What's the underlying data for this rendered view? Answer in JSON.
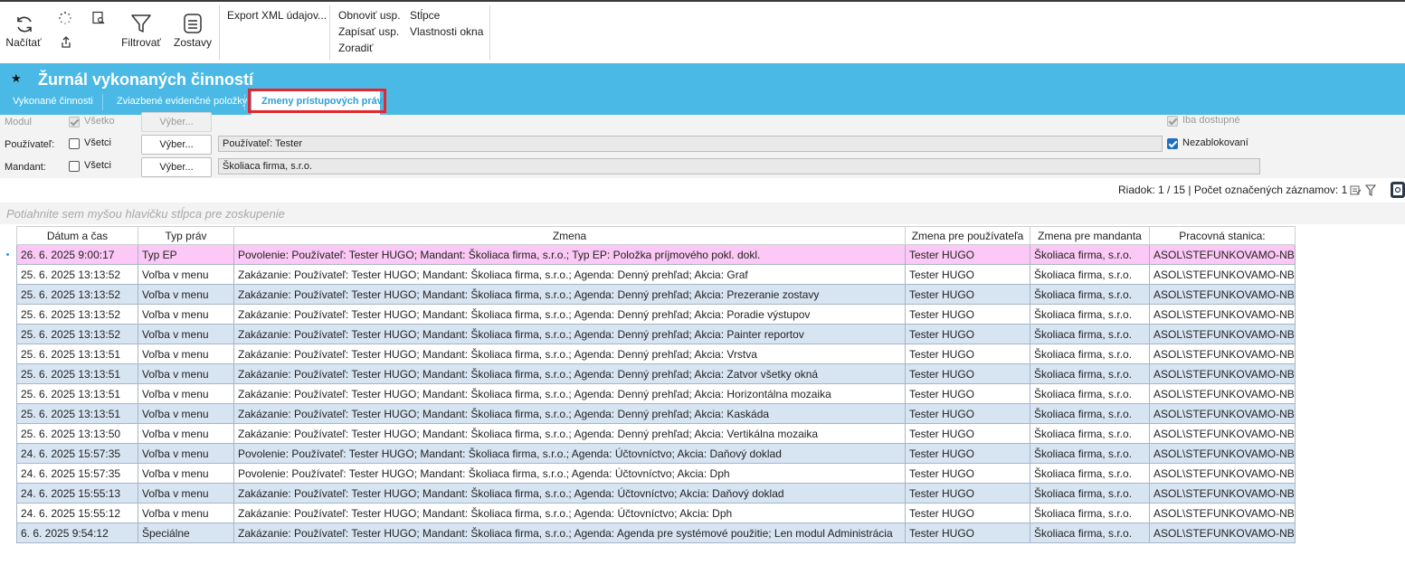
{
  "toolbar": {
    "load_label": "Načítať",
    "filter_label": "Filtrovať",
    "reports_label": "Zostavy",
    "export_xml_label": "Export XML údajov...",
    "refresh_settings_label": "Obnoviť usp.",
    "save_settings_label": "Zapísať usp.",
    "sort_label": "Zoradiť",
    "columns_label": "Stĺpce",
    "window_properties_label": "Vlastnosti okna"
  },
  "window": {
    "title": "Žurnál vykonaných činností",
    "tabs": [
      "Vykonané činnosti",
      "Zviazbené evidenčné položky",
      "Zmeny prístupových práv"
    ],
    "active_tab": "Zmeny prístupových práv"
  },
  "filters": {
    "module_label": "Modul",
    "module_all_label": "Všetko",
    "user_label": "Používateľ:",
    "user_all_label": "Všetci",
    "mandant_label": "Mandant:",
    "mandant_all_label": "Všetci",
    "select_button": "Výber...",
    "user_value": "Používateľ: Tester",
    "mandant_value": "Školiaca firma, s.r.o.",
    "only_available_label": "Iba dostupné",
    "unblocked_label": "Nezablokovaní"
  },
  "status": {
    "text": "Riadok: 1 / 15 | Počet označených záznamov: 1"
  },
  "group_hint": "Potiahnite sem myšou hlavičku stĺpca pre zoskupenie",
  "grid": {
    "columns": [
      "Dátum a čas",
      "Typ práv",
      "Zmena",
      "Zmena pre používateľa",
      "Zmena pre mandanta",
      "Pracovná stanica:"
    ],
    "rows": [
      [
        "26. 6. 2025 9:00:17",
        "Typ EP",
        "Povolenie: Používateľ: Tester HUGO; Mandant: Školiaca firma, s.r.o.; Typ EP: Položka príjmového pokl. dokl.",
        "Tester HUGO",
        "Školiaca firma, s.r.o.",
        "ASOL\\STEFUNKOVAMO-NB"
      ],
      [
        "25. 6. 2025 13:13:52",
        "Voľba v menu",
        "Zakázanie: Používateľ: Tester HUGO; Mandant: Školiaca firma, s.r.o.; Agenda: Denný prehľad; Akcia: Graf",
        "Tester HUGO",
        "Školiaca firma, s.r.o.",
        "ASOL\\STEFUNKOVAMO-NB"
      ],
      [
        "25. 6. 2025 13:13:52",
        "Voľba v menu",
        "Zakázanie: Používateľ: Tester HUGO; Mandant: Školiaca firma, s.r.o.; Agenda: Denný prehľad; Akcia: Prezeranie zostavy",
        "Tester HUGO",
        "Školiaca firma, s.r.o.",
        "ASOL\\STEFUNKOVAMO-NB"
      ],
      [
        "25. 6. 2025 13:13:52",
        "Voľba v menu",
        "Zakázanie: Používateľ: Tester HUGO; Mandant: Školiaca firma, s.r.o.; Agenda: Denný prehľad; Akcia: Poradie výstupov",
        "Tester HUGO",
        "Školiaca firma, s.r.o.",
        "ASOL\\STEFUNKOVAMO-NB"
      ],
      [
        "25. 6. 2025 13:13:52",
        "Voľba v menu",
        "Zakázanie: Používateľ: Tester HUGO; Mandant: Školiaca firma, s.r.o.; Agenda: Denný prehľad; Akcia: Painter reportov",
        "Tester HUGO",
        "Školiaca firma, s.r.o.",
        "ASOL\\STEFUNKOVAMO-NB"
      ],
      [
        "25. 6. 2025 13:13:51",
        "Voľba v menu",
        "Zakázanie: Používateľ: Tester HUGO; Mandant: Školiaca firma, s.r.o.; Agenda: Denný prehľad; Akcia: Vrstva",
        "Tester HUGO",
        "Školiaca firma, s.r.o.",
        "ASOL\\STEFUNKOVAMO-NB"
      ],
      [
        "25. 6. 2025 13:13:51",
        "Voľba v menu",
        "Zakázanie: Používateľ: Tester HUGO; Mandant: Školiaca firma, s.r.o.; Agenda: Denný prehľad; Akcia: Zatvor všetky okná",
        "Tester HUGO",
        "Školiaca firma, s.r.o.",
        "ASOL\\STEFUNKOVAMO-NB"
      ],
      [
        "25. 6. 2025 13:13:51",
        "Voľba v menu",
        "Zakázanie: Používateľ: Tester HUGO; Mandant: Školiaca firma, s.r.o.; Agenda: Denný prehľad; Akcia: Horizontálna mozaika",
        "Tester HUGO",
        "Školiaca firma, s.r.o.",
        "ASOL\\STEFUNKOVAMO-NB"
      ],
      [
        "25. 6. 2025 13:13:51",
        "Voľba v menu",
        "Zakázanie: Používateľ: Tester HUGO; Mandant: Školiaca firma, s.r.o.; Agenda: Denný prehľad; Akcia: Kaskáda",
        "Tester HUGO",
        "Školiaca firma, s.r.o.",
        "ASOL\\STEFUNKOVAMO-NB"
      ],
      [
        "25. 6. 2025 13:13:50",
        "Voľba v menu",
        "Zakázanie: Používateľ: Tester HUGO; Mandant: Školiaca firma, s.r.o.; Agenda: Denný prehľad; Akcia: Vertikálna mozaika",
        "Tester HUGO",
        "Školiaca firma, s.r.o.",
        "ASOL\\STEFUNKOVAMO-NB"
      ],
      [
        "24. 6. 2025 15:57:35",
        "Voľba v menu",
        "Povolenie: Používateľ: Tester HUGO; Mandant: Školiaca firma, s.r.o.; Agenda: Účtovníctvo; Akcia: Daňový doklad",
        "Tester HUGO",
        "Školiaca firma, s.r.o.",
        "ASOL\\STEFUNKOVAMO-NB"
      ],
      [
        "24. 6. 2025 15:57:35",
        "Voľba v menu",
        "Povolenie: Používateľ: Tester HUGO; Mandant: Školiaca firma, s.r.o.; Agenda: Účtovníctvo; Akcia: Dph",
        "Tester HUGO",
        "Školiaca firma, s.r.o.",
        "ASOL\\STEFUNKOVAMO-NB"
      ],
      [
        "24. 6. 2025 15:55:13",
        "Voľba v menu",
        "Zakázanie: Používateľ: Tester HUGO; Mandant: Školiaca firma, s.r.o.; Agenda: Účtovníctvo; Akcia: Daňový doklad",
        "Tester HUGO",
        "Školiaca firma, s.r.o.",
        "ASOL\\STEFUNKOVAMO-NB"
      ],
      [
        "24. 6. 2025 15:55:12",
        "Voľba v menu",
        "Zakázanie: Používateľ: Tester HUGO; Mandant: Školiaca firma, s.r.o.; Agenda: Účtovníctvo; Akcia: Dph",
        "Tester HUGO",
        "Školiaca firma, s.r.o.",
        "ASOL\\STEFUNKOVAMO-NB"
      ],
      [
        "6. 6. 2025 9:54:12",
        "Špeciálne",
        "Zakázanie: Používateľ: Tester HUGO; Mandant: Školiaca firma, s.r.o.; Agenda: Agenda pre systémové použitie; Len modul Administrácia",
        "Tester HUGO",
        "Školiaca firma, s.r.o.",
        "ASOL\\STEFUNKOVAMO-NB"
      ]
    ]
  },
  "colors": {
    "title_bar": "#4ab9e6",
    "selected_row": "#fcc8f6",
    "alt_row": "#d7e4f2",
    "highlight_box": "#e8242c"
  }
}
